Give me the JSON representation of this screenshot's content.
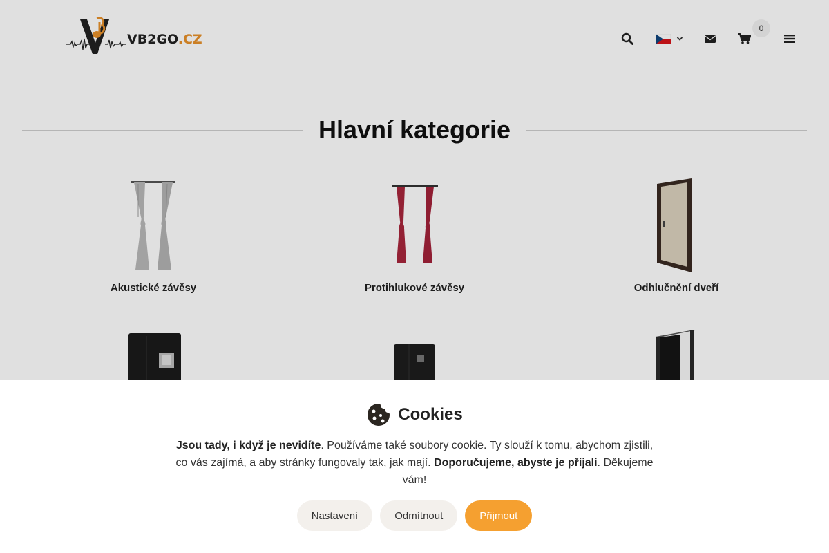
{
  "header": {
    "logo_text_main": "VB2GO",
    "logo_text_tld": ".CZ",
    "cart_count": "0",
    "icons": [
      "search-icon",
      "flag-cz-icon",
      "chevron-down-icon",
      "mail-icon",
      "cart-icon",
      "menu-icon"
    ]
  },
  "main": {
    "title": "Hlavní kategorie",
    "categories": [
      {
        "label": "Akustické závěsy"
      },
      {
        "label": "Protihlukové závěsy"
      },
      {
        "label": "Odhlučnění dveří"
      },
      {
        "label": ""
      },
      {
        "label": ""
      },
      {
        "label": ""
      }
    ]
  },
  "cookie": {
    "title": "Cookies",
    "text_bold_1": "Jsou tady, i když je nevidíte",
    "text_1": ". Používáme také soubory cookie. Ty slouží k tomu, abychom zjistili, co vás zajímá, a aby stránky fungovaly tak, jak mají. ",
    "text_bold_2": "Doporučujeme, abyste je přijali",
    "text_2": ". Děkujeme vám!",
    "btn_settings": "Nastavení",
    "btn_reject": "Odmítnout",
    "btn_accept": "Přijmout"
  },
  "colors": {
    "accent": "#f5a030",
    "logo_orange": "#e8912b",
    "button_light": "#f3f0ec"
  }
}
